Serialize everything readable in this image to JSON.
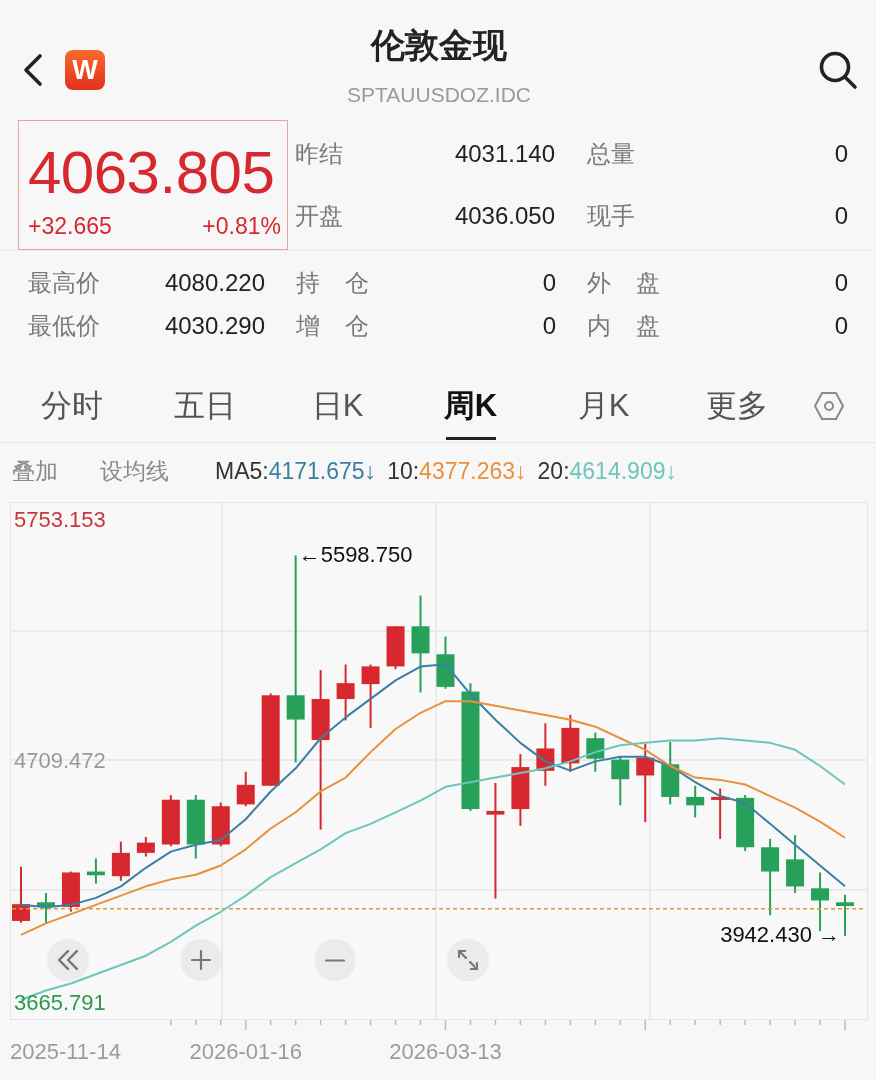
{
  "header": {
    "logo": "W",
    "title": "伦敦金现",
    "symbol": "SPTAUUSDOZ.IDC"
  },
  "quote": {
    "rising": true,
    "price": "4063.805",
    "change": "+32.665",
    "change_percent": "+0.81%",
    "side_rows": [
      [
        {
          "label": "昨结",
          "value": "4031.140"
        },
        {
          "label": "总量",
          "value": "0"
        }
      ],
      [
        {
          "label": "开盘",
          "value": "4036.050"
        },
        {
          "label": "现手",
          "value": "0"
        }
      ]
    ],
    "detail_rows": [
      [
        {
          "label": "最高价",
          "value": "4080.220"
        },
        {
          "label": "持 仓",
          "value": "0"
        },
        {
          "label": "外 盘",
          "value": "0"
        }
      ],
      [
        {
          "label": "最低价",
          "value": "4030.290"
        },
        {
          "label": "增 仓",
          "value": "0"
        },
        {
          "label": "内 盘",
          "value": "0"
        }
      ]
    ]
  },
  "tabs": [
    {
      "label": "分时",
      "selected": false
    },
    {
      "label": "五日",
      "selected": false
    },
    {
      "label": "日K",
      "selected": false
    },
    {
      "label": "周K",
      "selected": true
    },
    {
      "label": "月K",
      "selected": false
    },
    {
      "label": "更多",
      "selected": false
    }
  ],
  "indicators": {
    "overlay": "叠加",
    "set_ma": "设均线",
    "ma": [
      {
        "label": "MA5:",
        "value": "4171.675↓",
        "color": "#3b7fa4"
      },
      {
        "label": "10:",
        "value": "4377.263↓",
        "color": "#e8913a"
      },
      {
        "label": "20:",
        "value": "4614.909↓",
        "color": "#6cc6be"
      }
    ]
  },
  "chart": {
    "chart_data": {
      "type": "line",
      "categories": [
        null,
        null,
        null,
        null,
        null,
        null,
        null,
        null,
        null,
        "2026-01-16",
        null,
        null,
        null,
        null,
        null,
        null,
        null,
        "2026-03-13",
        null,
        null,
        null,
        null,
        null,
        null,
        null,
        null,
        null,
        null,
        null,
        null,
        null,
        null,
        null,
        null
      ],
      "ylim": [
        3592.32,
        5830.94
      ],
      "yticks": [
        {
          "value": 5753.153,
          "label": "5753.153"
        },
        {
          "value": 4709.472,
          "label": "4709.472"
        },
        {
          "value": 3665.791,
          "label": "3665.791"
        }
      ],
      "series": [
        {
          "color": "#3b7fa4",
          "values": [
            4090,
            4080,
            4090,
            4120,
            4170,
            4250,
            4320,
            4350,
            4370,
            4460,
            4580,
            4680,
            4810,
            4900,
            4980,
            5060,
            5120,
            5130,
            5000,
            4890,
            4790,
            4710,
            4670,
            4710,
            4730,
            4730,
            4690,
            4620,
            4560,
            4530,
            4440,
            4350,
            4260,
            4170
          ]
        },
        {
          "color": "#e8913a",
          "values": [
            3960,
            4010,
            4050,
            4090,
            4130,
            4170,
            4200,
            4220,
            4260,
            4330,
            4420,
            4490,
            4580,
            4640,
            4750,
            4850,
            4920,
            4970,
            4970,
            4950,
            4930,
            4910,
            4890,
            4860,
            4810,
            4760,
            4690,
            4640,
            4630,
            4610,
            4560,
            4510,
            4450,
            4380
          ]
        },
        {
          "color": "#6cc6be",
          "values": [
            3680,
            3720,
            3750,
            3790,
            3830,
            3870,
            3930,
            4000,
            4060,
            4130,
            4210,
            4270,
            4330,
            4400,
            4440,
            4490,
            4540,
            4600,
            4620,
            4640,
            4660,
            4680,
            4710,
            4750,
            4780,
            4790,
            4800,
            4800,
            4810,
            4800,
            4790,
            4760,
            4690,
            4610
          ]
        }
      ],
      "annotations": [
        "←5598.750",
        "3942.430 →"
      ]
    },
    "x_axis_start_label": "2025-11-14"
  }
}
